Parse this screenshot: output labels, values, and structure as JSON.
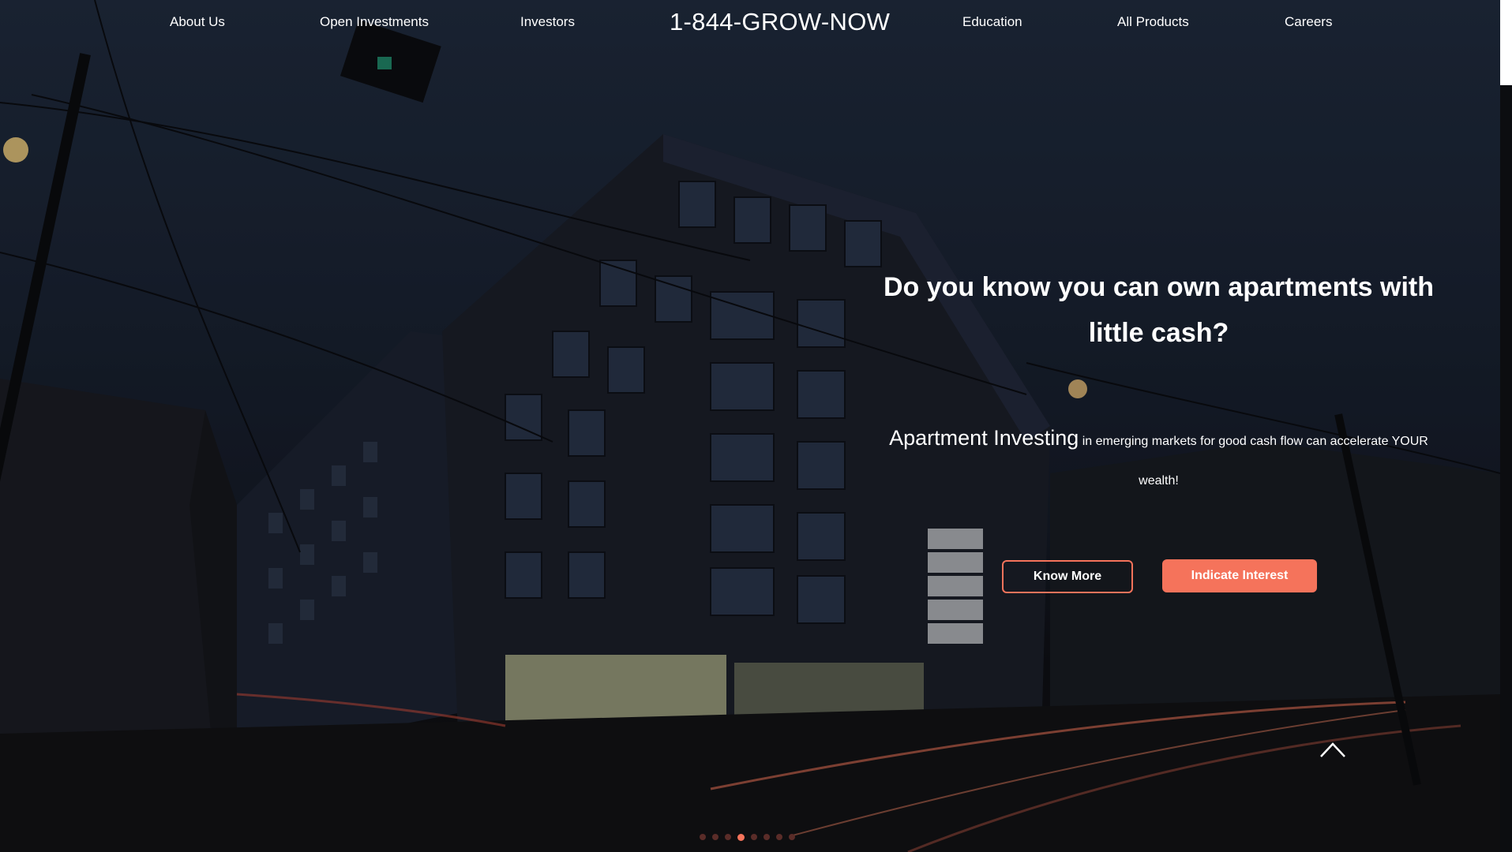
{
  "nav": {
    "links": [
      "About Us",
      "Open Investments",
      "Investors",
      "Education",
      "All Products",
      "Careers"
    ],
    "phone": "1-844-GROW-NOW"
  },
  "hero": {
    "headline": "Do you know you can own apartments with little cash?",
    "sub_big": "Apartment Investing",
    "sub_small": " in emerging markets for good cash flow can accelerate YOUR wealth!",
    "know_more": "Know More",
    "indicate_interest": "Indicate Interest"
  },
  "carousel": {
    "count": 8,
    "active_index": 3
  },
  "colors": {
    "accent": "#f5735b",
    "overlay": "#101521"
  },
  "icons": {
    "scroll_top": "chevron-up-icon"
  }
}
